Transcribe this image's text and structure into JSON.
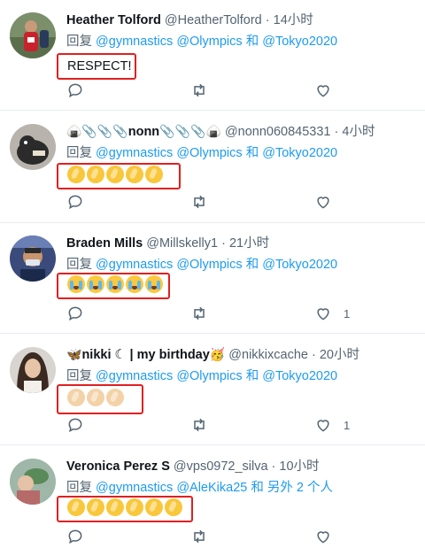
{
  "tweets": [
    {
      "name": "Heather Tolford",
      "handle": "@HeatherTolford",
      "time": "14小时",
      "reply_prefix": "回复",
      "mentions": [
        "@gymnastics",
        "@Olympics"
      ],
      "joiner": "和",
      "last_mention": "@Tokyo2020",
      "content_text": "RESPECT!",
      "like_count": ""
    },
    {
      "name": "nonn",
      "name_prefix_emoji": "🍙📎📎📎",
      "name_suffix_emoji": "📎📎📎🍙",
      "handle": "@nonn060845331",
      "time": "4小时",
      "reply_prefix": "回复",
      "mentions": [
        "@gymnastics",
        "@Olympics"
      ],
      "joiner": "和",
      "last_mention": "@Tokyo2020",
      "content_emoji": "👏👏👏👏👏",
      "like_count": ""
    },
    {
      "name": "Braden Mills",
      "handle": "@Millskelly1",
      "time": "21小时",
      "reply_prefix": "回复",
      "mentions": [
        "@gymnastics",
        "@Olympics"
      ],
      "joiner": "和",
      "last_mention": "@Tokyo2020",
      "content_emoji": "😭😭😭😭😭",
      "like_count": "1"
    },
    {
      "name": "nikki ☾ | my birthday",
      "name_prefix_emoji": "🦋",
      "name_suffix_emoji": "🥳",
      "handle": "@nikkixcache",
      "time": "20小时",
      "reply_prefix": "回复",
      "mentions": [
        "@gymnastics",
        "@Olympics"
      ],
      "joiner": "和",
      "last_mention": "@Tokyo2020",
      "content_emoji": "👏🏼👏🏼👏🏼",
      "like_count": "1"
    },
    {
      "name": "Veronica Perez S",
      "handle": "@vps0972_silva",
      "time": "10小时",
      "reply_prefix": "回复",
      "mentions": [
        "@gymnastics",
        "@AleKika25"
      ],
      "joiner": "和",
      "last_mention": "另外 2 个人",
      "content_emoji": "👏👏👏👏👏👏",
      "like_count": ""
    }
  ],
  "sep": " · ",
  "icons": [
    "reply-icon",
    "retweet-icon",
    "like-icon"
  ],
  "colors": {
    "mention": "#1d9bf0",
    "highlight_box": "#e02020",
    "meta": "#536471"
  }
}
